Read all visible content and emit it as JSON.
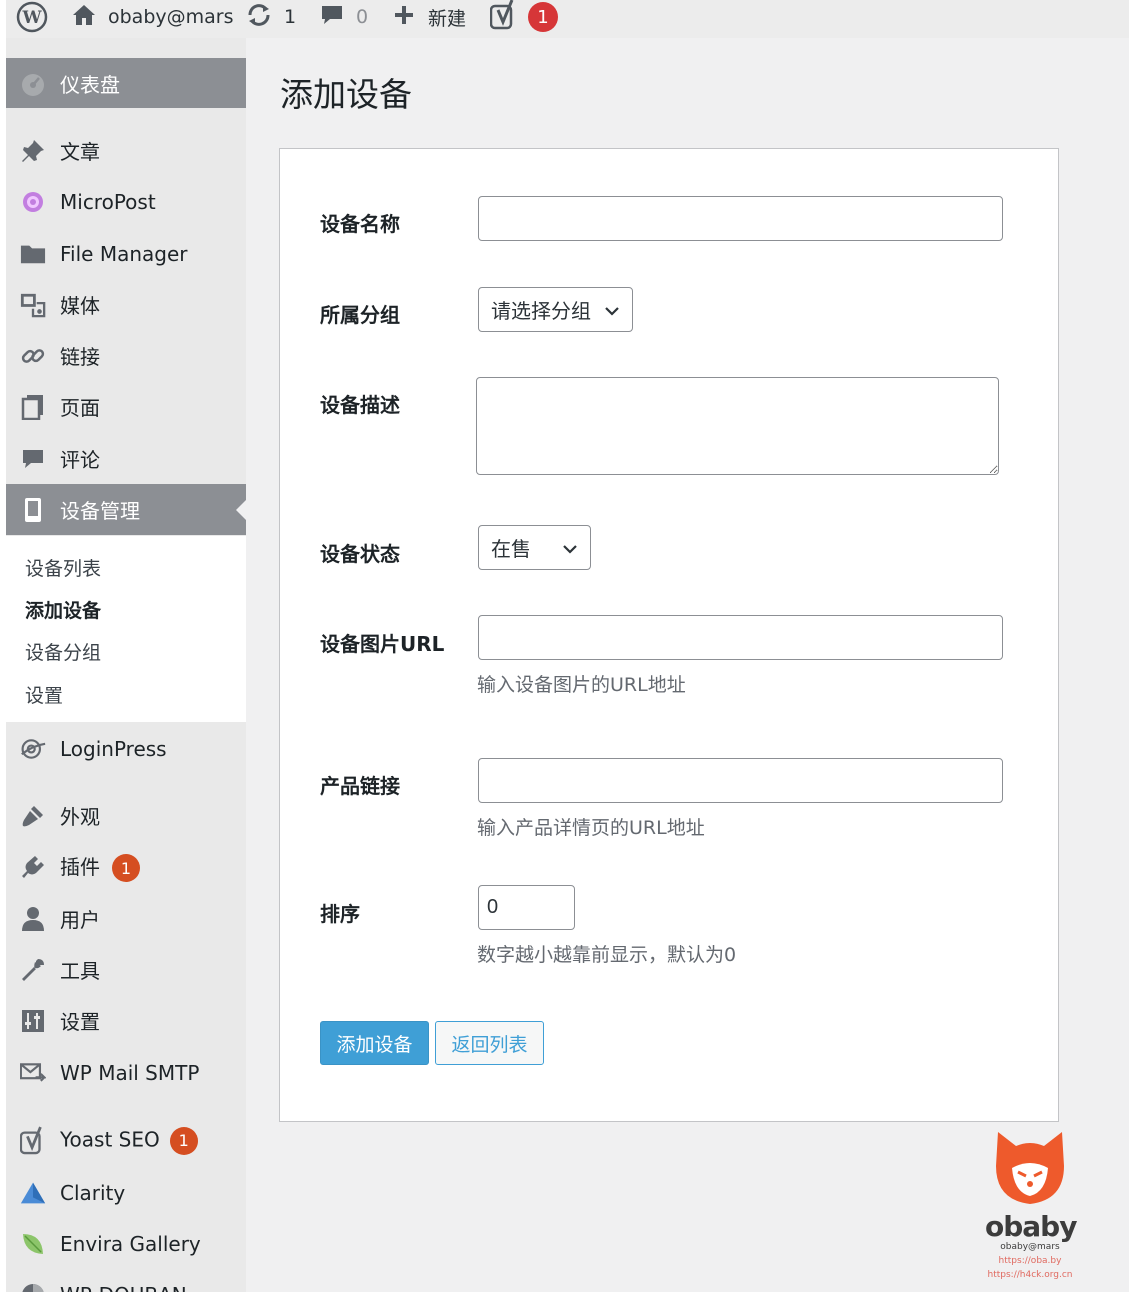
{
  "adminbar": {
    "site_name": "obaby@mars",
    "updates_count": "1",
    "comments_count": "0",
    "new_label": "新建",
    "yoast_badge": "1"
  },
  "sidebar": {
    "dashboard": "仪表盘",
    "posts": "文章",
    "micropost": "MicroPost",
    "file_manager": "File Manager",
    "media": "媒体",
    "links": "链接",
    "pages": "页面",
    "comments": "评论",
    "device_mgmt": "设备管理",
    "submenu": {
      "list": "设备列表",
      "add": "添加设备",
      "groups": "设备分组",
      "settings": "设置"
    },
    "loginpress": "LoginPress",
    "appearance": "外观",
    "plugins": "插件",
    "plugins_badge": "1",
    "users": "用户",
    "tools": "工具",
    "settings": "设置",
    "wp_mail_smtp": "WP Mail SMTP",
    "yoast_seo": "Yoast SEO",
    "yoast_badge": "1",
    "clarity": "Clarity",
    "envira": "Envira Gallery",
    "wp_douban": "WP-DOUBAN"
  },
  "main": {
    "title": "添加设备",
    "form": {
      "name_label": "设备名称",
      "name_value": "",
      "group_label": "所属分组",
      "group_selected": "请选择分组",
      "desc_label": "设备描述",
      "desc_value": "",
      "status_label": "设备状态",
      "status_selected": "在售",
      "image_label": "设备图片URL",
      "image_value": "",
      "image_help": "输入设备图片的URL地址",
      "link_label": "产品链接",
      "link_value": "",
      "link_help": "输入产品详情页的URL地址",
      "sort_label": "排序",
      "sort_value": "0",
      "sort_help": "数字越小越靠前显示，默认为0",
      "submit_label": "添加设备",
      "back_label": "返回列表"
    }
  },
  "watermark": {
    "brand": "obaby",
    "handle": "obaby@mars",
    "url1": "https://oba.by",
    "url2": "https://h4ck.org.cn"
  },
  "colors": {
    "primary_button": "#3f9fd6",
    "badge_red": "#d63638",
    "menu_badge": "#d54e21",
    "active_menu": "#8c8f94"
  }
}
